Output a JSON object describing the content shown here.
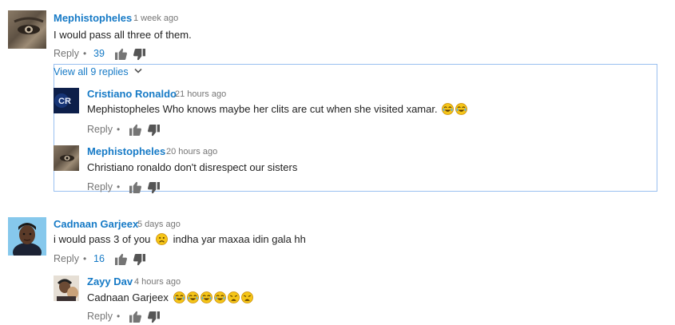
{
  "threads": [
    {
      "author": "Mephistopheles",
      "time": "1 week ago",
      "text": "I would pass all three of them.",
      "reply_label": "Reply",
      "likes": "39",
      "view_replies": "View all 9 replies",
      "replies": [
        {
          "author": "Cristiano Ronaldo",
          "time": "21 hours ago",
          "text": "Mephistopheles Who knows maybe her clits are cut when she visited xamar.",
          "emoji": [
            "joy-emoji",
            "joy-emoji"
          ],
          "reply_label": "Reply"
        },
        {
          "author": "Mephistopheles",
          "time": "20 hours ago",
          "text": "Christiano ronaldo don't disrespect our sisters",
          "reply_label": "Reply"
        }
      ]
    },
    {
      "author": "Cadnaan Garjeex",
      "time": "5 days ago",
      "text_before": "i would pass 3 of you",
      "text_after": "indha yar maxaa idin gala hh",
      "emoji": [
        "frown-emoji"
      ],
      "reply_label": "Reply",
      "likes": "16",
      "replies": [
        {
          "author": "Zayy Dav",
          "time": "4 hours ago",
          "text": "Cadnaan Garjeex",
          "emoji": [
            "joy-emoji",
            "joy-emoji",
            "joy-emoji",
            "joy-emoji",
            "weary-emoji",
            "weary-emoji"
          ],
          "reply_label": "Reply"
        }
      ]
    }
  ],
  "colors": {
    "link": "#167ac6",
    "meta": "#767676",
    "border": "#9ac0f0",
    "emoji": "#f5c518"
  }
}
